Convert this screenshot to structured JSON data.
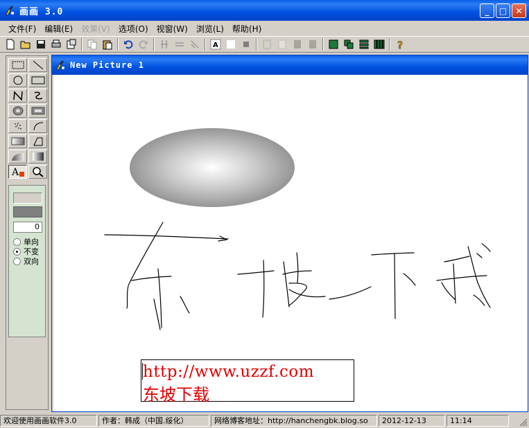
{
  "window": {
    "title": "画画 3.0",
    "minimize": "_",
    "maximize": "□",
    "close": "✕"
  },
  "menu": [
    {
      "label": "文件(F)",
      "enabled": true
    },
    {
      "label": "编辑(E)",
      "enabled": true
    },
    {
      "label": "效果(V)",
      "enabled": false
    },
    {
      "label": "选项(O)",
      "enabled": true
    },
    {
      "label": "视窗(W)",
      "enabled": true
    },
    {
      "label": "浏览(L)",
      "enabled": true
    },
    {
      "label": "帮助(H)",
      "enabled": true
    }
  ],
  "toolbar_icons": [
    "new-file-icon",
    "open-folder-icon",
    "save-icon",
    "print-icon",
    "properties-icon",
    "copy-icon",
    "paste-icon",
    "undo-icon",
    "redo-icon",
    "flip-vertical-icon",
    "flip-horizontal-icon",
    "rotate-icon",
    "text-style-icon",
    "white-color-icon",
    "gray-color-icon",
    "frame1-icon",
    "frame2-icon",
    "frame3-icon",
    "frame4-icon",
    "layout-single-icon",
    "layout-cascade-icon",
    "layout-horizontal-icon",
    "layout-vertical-icon",
    "help-icon"
  ],
  "tools": [
    "rect-select-tool",
    "line-tool",
    "ellipse-tool",
    "rectangle-tool",
    "polyline-tool",
    "freehand-tool",
    "filled-ellipse-tool",
    "filled-rect-tool",
    "spray-tool",
    "arc-tool",
    "gradient-rect-tool",
    "polygon-tool",
    "gradient-arc-tool",
    "gradient-fill-tool",
    "text-tool",
    "zoom-tool"
  ],
  "options": {
    "line_width": "0",
    "radio": [
      {
        "label": "单向",
        "checked": false
      },
      {
        "label": "不变",
        "checked": true
      },
      {
        "label": "双向",
        "checked": false
      }
    ]
  },
  "document": {
    "title": "New Picture 1",
    "text_line1": "http://www.uzzf.com",
    "text_line2": "东坡下载",
    "text_color": "#e00000"
  },
  "statusbar": {
    "welcome": "欢迎使用画画软件3.0",
    "author": "作者：韩成（中国.绥化）",
    "blog": "网络博客地址：http://hanchengbk.blog.so",
    "date": "2012-12-13",
    "time": "11:14"
  },
  "colors": {
    "titlebar": "#0052e0",
    "chrome": "#d4d0c8",
    "canvas": "#ffffff"
  }
}
